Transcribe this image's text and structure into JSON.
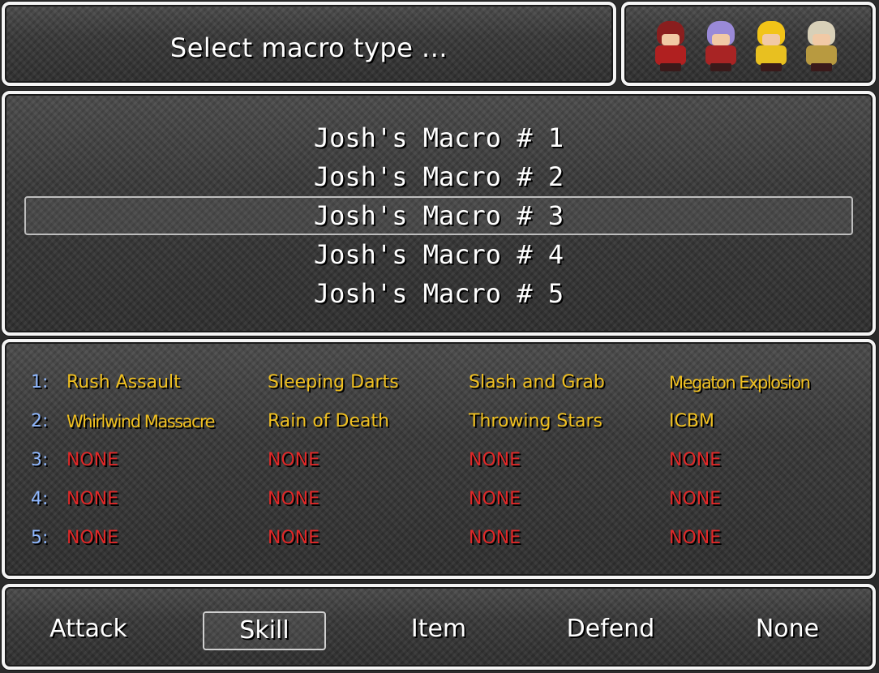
{
  "title_window": {
    "title": "Select macro type ..."
  },
  "party": [
    {
      "icon": "red-armored-hero-sprite",
      "hair": "#8a1e1e",
      "body": "#b02020"
    },
    {
      "icon": "purple-haired-warrior-sprite",
      "hair": "#9a8ad8",
      "body": "#a82424"
    },
    {
      "icon": "blonde-child-sprite",
      "hair": "#f2c418",
      "body": "#e8c020"
    },
    {
      "icon": "white-haired-elder-sprite",
      "hair": "#d8d0b8",
      "body": "#b89a40"
    }
  ],
  "macros": [
    {
      "label": "Josh's Macro # 1"
    },
    {
      "label": "Josh's Macro # 2"
    },
    {
      "label": "Josh's Macro # 3",
      "selected": true
    },
    {
      "label": "Josh's Macro # 4"
    },
    {
      "label": "Josh's Macro # 5"
    }
  ],
  "detail_rows": [
    {
      "num": "1:",
      "cells": [
        "Rush Assault",
        "Sleeping Darts",
        "Slash and Grab",
        "Megaton Explosion"
      ]
    },
    {
      "num": "2:",
      "cells": [
        "Whirlwind Massacre",
        "Rain of Death",
        "Throwing Stars",
        "ICBM"
      ]
    },
    {
      "num": "3:",
      "cells": [
        "NONE",
        "NONE",
        "NONE",
        "NONE"
      ]
    },
    {
      "num": "4:",
      "cells": [
        "NONE",
        "NONE",
        "NONE",
        "NONE"
      ]
    },
    {
      "num": "5:",
      "cells": [
        "NONE",
        "NONE",
        "NONE",
        "NONE"
      ]
    }
  ],
  "commands": [
    {
      "label": "Attack"
    },
    {
      "label": "Skill",
      "selected": true
    },
    {
      "label": "Item"
    },
    {
      "label": "Defend"
    },
    {
      "label": "None"
    }
  ],
  "colors": {
    "window_border": "#f4f4f4",
    "skill_text": "#f0c020",
    "none_text": "#e02828",
    "row_number": "#8fb8ff"
  }
}
